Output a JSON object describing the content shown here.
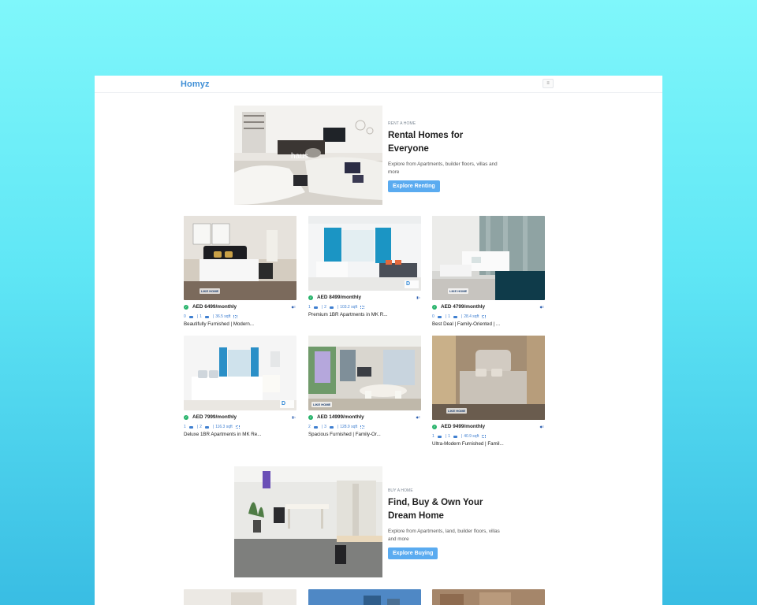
{
  "header": {
    "logo": "Homyz",
    "menu_icon": "≡"
  },
  "rent_hero": {
    "eyebrow": "RENT A HOME",
    "title_line1": "Rental Homes for",
    "title_line2": "Everyone",
    "description": "Explore from Apartments, builder floors, villas and more",
    "button": "Explore Renting",
    "image_caption": "haus"
  },
  "rent_listings": [
    {
      "price": "AED 6499/monthly",
      "beds": "0",
      "baths": "1",
      "area": "36.5 sqft",
      "title": "Beautifully Furnished | Modern..."
    },
    {
      "price": "AED 8499/monthly",
      "beds": "1",
      "baths": "2",
      "area": "103.2 sqft",
      "title": "Premium 1BR Apartments in MK R..."
    },
    {
      "price": "AED 4799/monthly",
      "beds": "0",
      "baths": "1",
      "area": "28.4 sqft",
      "title": "Best Deal | Family-Oriented | ..."
    },
    {
      "price": "AED 7999/monthly",
      "beds": "1",
      "baths": "2",
      "area": "116.3 sqft",
      "title": "Deluxe 1BR Apartments in MK Re..."
    },
    {
      "price": "AED 14999/monthly",
      "beds": "2",
      "baths": "3",
      "area": "128.9 sqft",
      "title": "Spacious Furnished | Family-Or..."
    },
    {
      "price": "AED 9499/monthly",
      "beds": "1",
      "baths": "1",
      "area": "40.9 sqft",
      "title": "Ultra-Modern Furnished | Famil..."
    }
  ],
  "buy_hero": {
    "eyebrow": "BUY A HOME",
    "title_line1": "Find, Buy & Own Your",
    "title_line2": "Dream Home",
    "description": "Explore from Apartments, land, builder floors, villas and more",
    "button": "Explore Buying"
  },
  "watermarks": {
    "like_home": "LIKE HOME",
    "d": "D"
  },
  "colors": {
    "accent": "#5aabf0",
    "logo": "#3f8fd6",
    "verified": "#27b36b"
  }
}
